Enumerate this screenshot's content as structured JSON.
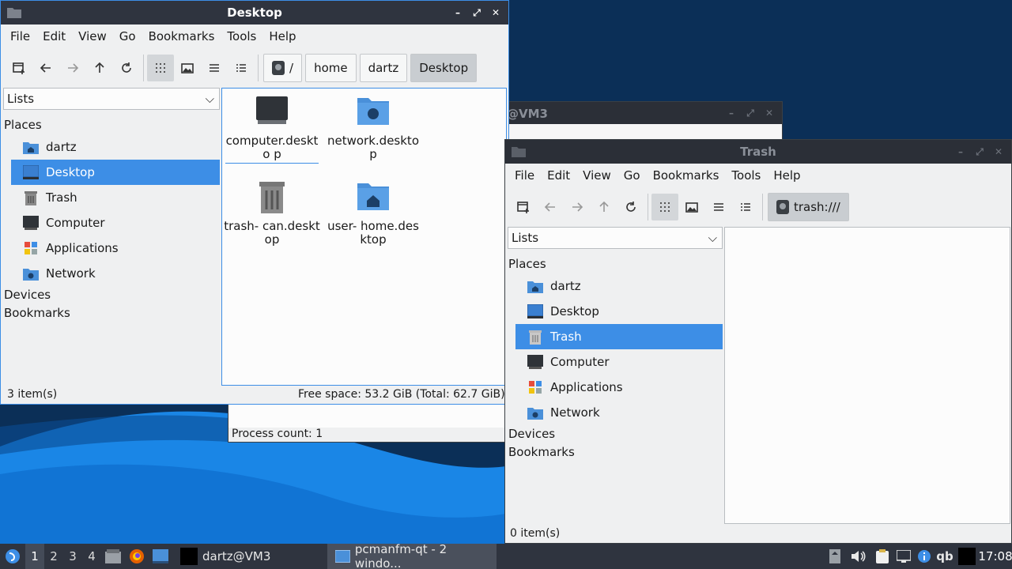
{
  "colors": {
    "accent": "#3d8ee6",
    "titlebar": "#2f343f",
    "taskbar": "#2f343f",
    "folder": "#4a90d9"
  },
  "bg_window": {
    "title": "@VM3",
    "status": "Process count: 1"
  },
  "desktop_window": {
    "title": "Desktop",
    "menu": [
      "File",
      "Edit",
      "View",
      "Go",
      "Bookmarks",
      "Tools",
      "Help"
    ],
    "breadcrumbs": [
      "/",
      "home",
      "dartz",
      "Desktop"
    ],
    "side_combo": "Lists",
    "sections": {
      "places": "Places",
      "devices": "Devices",
      "bookmarks": "Bookmarks"
    },
    "places": [
      {
        "label": "dartz",
        "icon": "home-folder-icon"
      },
      {
        "label": "Desktop",
        "icon": "desktop-icon"
      },
      {
        "label": "Trash",
        "icon": "trash-icon"
      },
      {
        "label": "Computer",
        "icon": "computer-icon"
      },
      {
        "label": "Applications",
        "icon": "applications-icon"
      },
      {
        "label": "Network",
        "icon": "network-icon"
      }
    ],
    "selected_place": "Desktop",
    "files": [
      {
        "label": "computer.deskto p",
        "icon": "computer-icon"
      },
      {
        "label": "network.desktop",
        "icon": "network-folder-icon"
      },
      {
        "label": "trash- can.desktop",
        "icon": "trash-icon"
      },
      {
        "label": "user- home.desktop",
        "icon": "home-folder-icon"
      }
    ],
    "status_left": "3 item(s)",
    "status_right": "Free space: 53.2 GiB (Total: 62.7 GiB)"
  },
  "trash_window": {
    "title": "Trash",
    "menu": [
      "File",
      "Edit",
      "View",
      "Go",
      "Bookmarks",
      "Tools",
      "Help"
    ],
    "location": "trash:///",
    "side_combo": "Lists",
    "sections": {
      "places": "Places",
      "devices": "Devices",
      "bookmarks": "Bookmarks"
    },
    "places": [
      {
        "label": "dartz",
        "icon": "home-folder-icon"
      },
      {
        "label": "Desktop",
        "icon": "desktop-icon"
      },
      {
        "label": "Trash",
        "icon": "trash-icon"
      },
      {
        "label": "Computer",
        "icon": "computer-icon"
      },
      {
        "label": "Applications",
        "icon": "applications-icon"
      },
      {
        "label": "Network",
        "icon": "network-icon"
      }
    ],
    "selected_place": "Trash",
    "status_left": "0 item(s)"
  },
  "taskbar": {
    "desktops": [
      "1",
      "2",
      "3",
      "4"
    ],
    "current_desktop": "1",
    "terminal_task": "dartz@VM3",
    "filemanager_task": "pcmanfm-qt - 2 windo...",
    "tray_qb": "qb",
    "clock": "17:08"
  }
}
